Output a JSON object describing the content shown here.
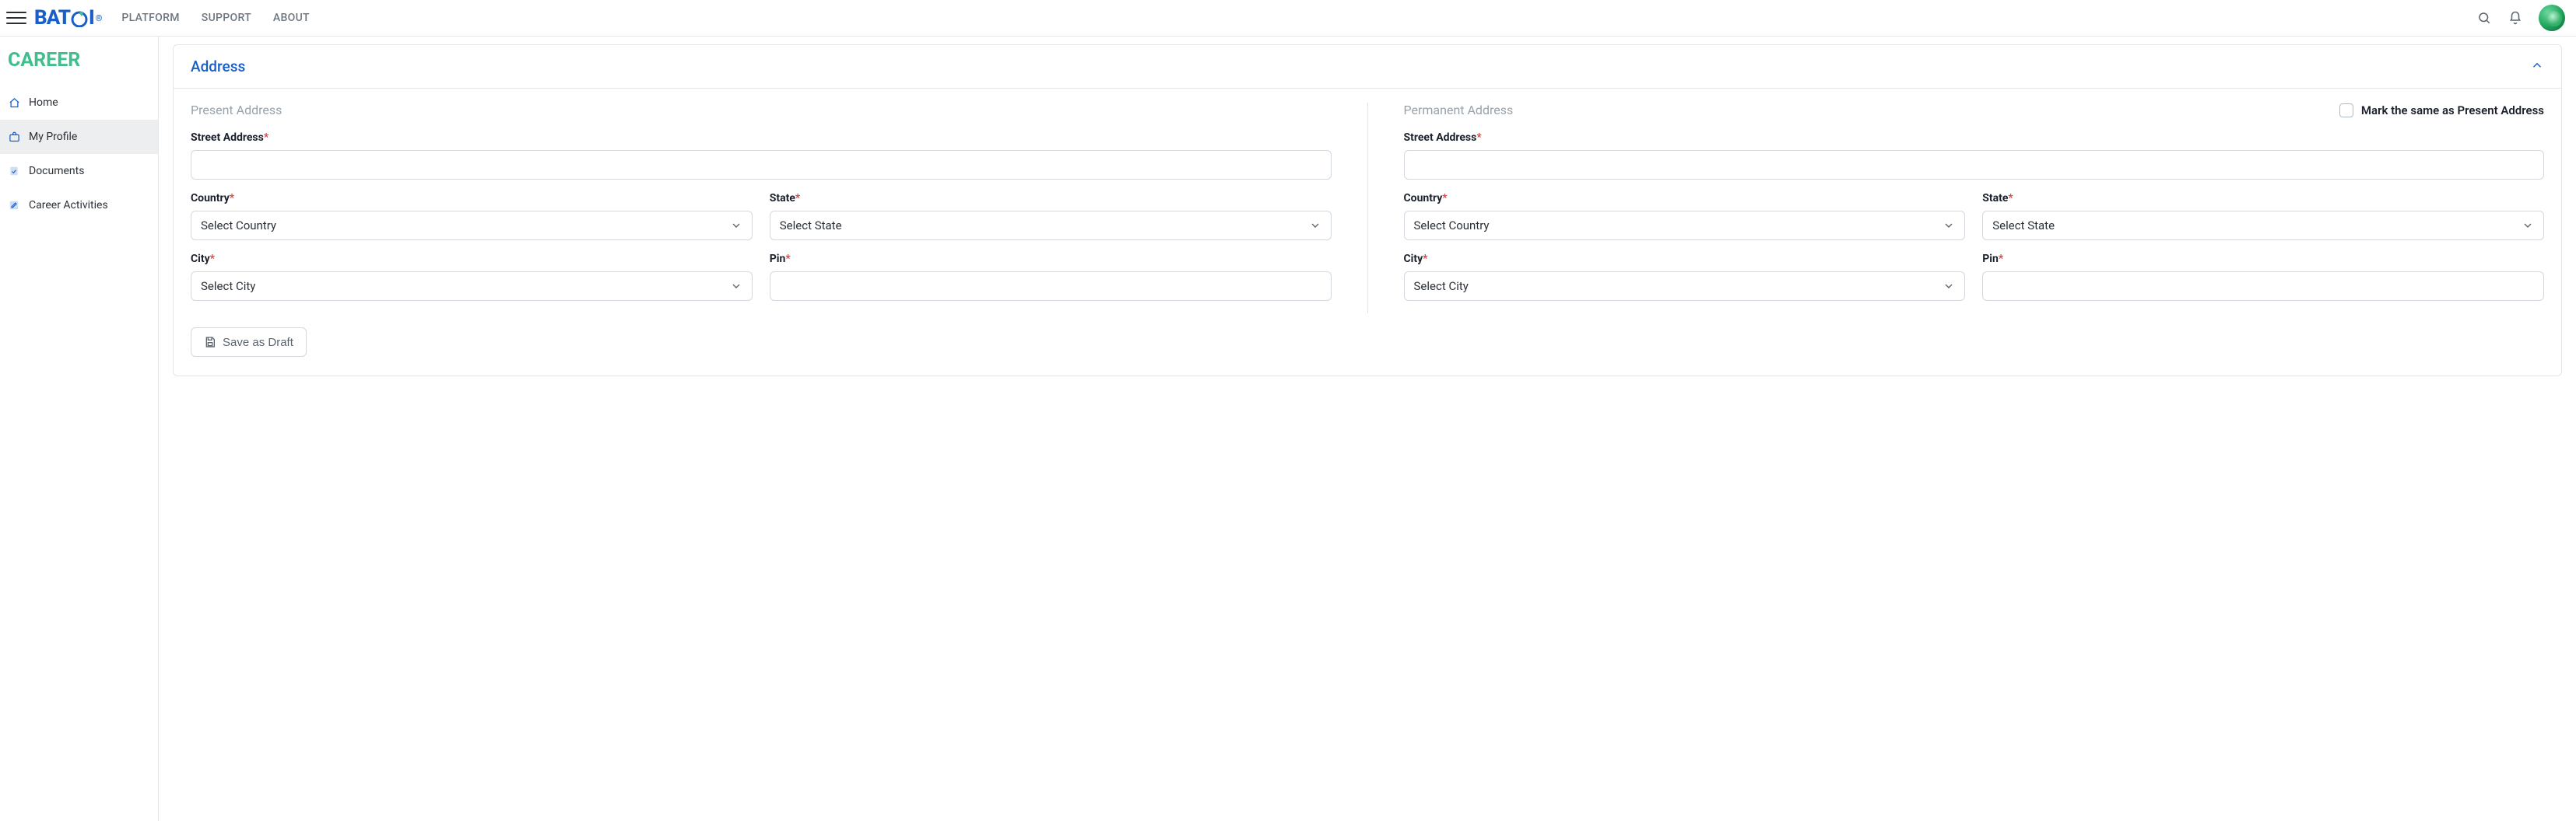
{
  "header": {
    "logo_text": "BAT I",
    "nav": {
      "platform": "PLATFORM",
      "support": "SUPPORT",
      "about": "ABOUT"
    }
  },
  "sidebar": {
    "title": "CAREER",
    "items": [
      {
        "label": "Home"
      },
      {
        "label": "My Profile"
      },
      {
        "label": "Documents"
      },
      {
        "label": "Career Activities"
      }
    ]
  },
  "panel": {
    "title": "Address",
    "save_as_draft": "Save as Draft",
    "present": {
      "header": "Present Address",
      "street": {
        "label": "Street Address",
        "value": ""
      },
      "country": {
        "label": "Country",
        "selected": "Select Country"
      },
      "state": {
        "label": "State",
        "selected": "Select State"
      },
      "city": {
        "label": "City",
        "selected": "Select City"
      },
      "pin": {
        "label": "Pin",
        "value": ""
      }
    },
    "permanent": {
      "header": "Permanent Address",
      "mark_same": "Mark the same as Present Address",
      "street": {
        "label": "Street Address",
        "value": ""
      },
      "country": {
        "label": "Country",
        "selected": "Select Country"
      },
      "state": {
        "label": "State",
        "selected": "Select State"
      },
      "city": {
        "label": "City",
        "selected": "Select City"
      },
      "pin": {
        "label": "Pin",
        "value": ""
      }
    }
  }
}
